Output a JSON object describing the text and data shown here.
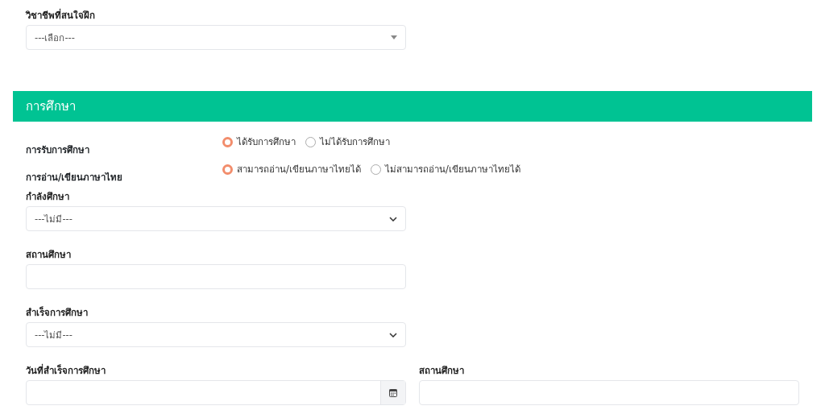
{
  "top_field": {
    "kind": "dropdown",
    "label": "วิชาชีพที่สนใจฝึก",
    "value": "---เลือก---"
  },
  "section": {
    "title": "การศึกษา"
  },
  "radio_groups": [
    {
      "label": "การรับการศึกษา",
      "options": [
        {
          "label": "ได้รับการศึกษา",
          "selected": true
        },
        {
          "label": "ไม่ได้รับการศึกษา",
          "selected": false
        }
      ]
    },
    {
      "label": "การอ่าน/เขียนภาษาไทย",
      "options": [
        {
          "label": "สามารถอ่าน/เขียนภาษาไทยได้",
          "selected": true
        },
        {
          "label": "ไม่สามารถอ่าน/เขียนภาษาไทยได้",
          "selected": false
        }
      ]
    }
  ],
  "rows": [
    [
      {
        "kind": "select",
        "label": "กำลังศึกษา",
        "value": "---ไม่มี---"
      }
    ],
    [
      {
        "kind": "text",
        "label": "สถานศึกษา"
      }
    ],
    [
      {
        "kind": "select",
        "label": "สำเร็จการศึกษา",
        "value": "---ไม่มี---"
      }
    ],
    [
      {
        "kind": "date",
        "label": "วันที่สำเร็จการศึกษา"
      },
      {
        "kind": "text",
        "label": "สถานศึกษา"
      }
    ]
  ]
}
